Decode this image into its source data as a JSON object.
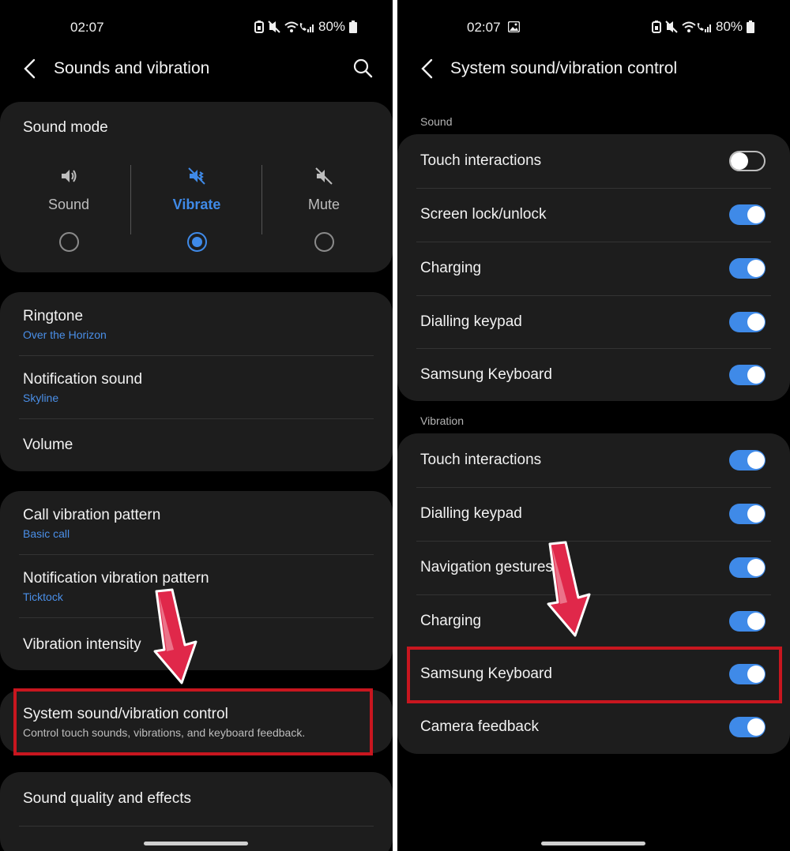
{
  "left": {
    "status": {
      "time": "02:07",
      "battery": "80%"
    },
    "appbar": {
      "title": "Sounds and vibration"
    },
    "sound_mode": {
      "title": "Sound mode",
      "options": [
        {
          "label": "Sound",
          "icon": "speaker-icon",
          "selected": false
        },
        {
          "label": "Vibrate",
          "icon": "vibrate-icon",
          "selected": true
        },
        {
          "label": "Mute",
          "icon": "mute-icon",
          "selected": false
        }
      ]
    },
    "group1": [
      {
        "title": "Ringtone",
        "subtitle": "Over the Horizon"
      },
      {
        "title": "Notification sound",
        "subtitle": "Skyline"
      },
      {
        "title": "Volume"
      }
    ],
    "group2": [
      {
        "title": "Call vibration pattern",
        "subtitle": "Basic call"
      },
      {
        "title": "Notification vibration pattern",
        "subtitle": "Ticktock"
      },
      {
        "title": "Vibration intensity"
      }
    ],
    "system_control": {
      "title": "System sound/vibration control",
      "subtitle": "Control touch sounds, vibrations, and keyboard feedback."
    },
    "sound_quality": {
      "title": "Sound quality and effects"
    }
  },
  "right": {
    "status": {
      "time": "02:07",
      "battery": "80%"
    },
    "appbar": {
      "title": "System sound/vibration control"
    },
    "sound_section": {
      "label": "Sound",
      "items": [
        {
          "label": "Touch interactions",
          "on": false
        },
        {
          "label": "Screen lock/unlock",
          "on": true
        },
        {
          "label": "Charging",
          "on": true
        },
        {
          "label": "Dialling keypad",
          "on": true
        },
        {
          "label": "Samsung Keyboard",
          "on": true
        }
      ]
    },
    "vibration_section": {
      "label": "Vibration",
      "items": [
        {
          "label": "Touch interactions",
          "on": true
        },
        {
          "label": "Dialling keypad",
          "on": true
        },
        {
          "label": "Navigation gestures",
          "on": true
        },
        {
          "label": "Charging",
          "on": true
        },
        {
          "label": "Samsung Keyboard",
          "on": true
        },
        {
          "label": "Camera feedback",
          "on": true
        }
      ]
    }
  },
  "colors": {
    "accent": "#3f8ae8",
    "card": "#1d1d1d",
    "highlight": "#c8161f",
    "arrow": "#e0284a"
  }
}
